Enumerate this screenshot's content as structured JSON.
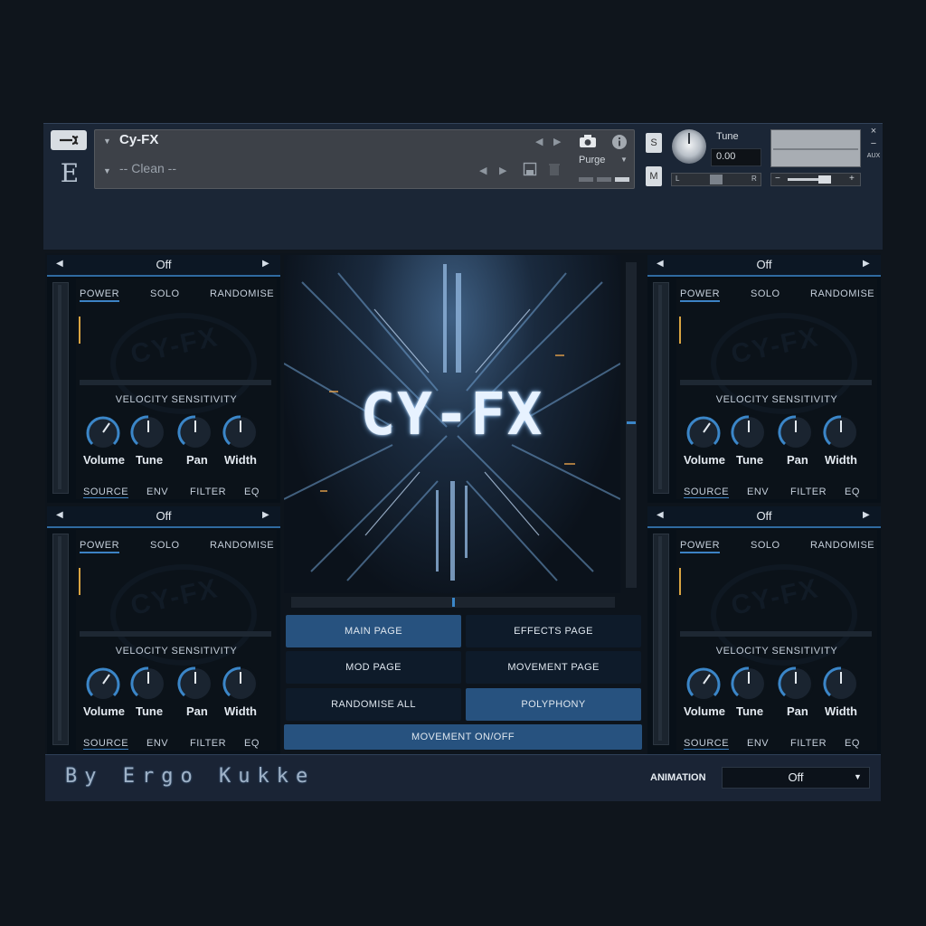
{
  "header": {
    "instrument_title": "Cy-FX",
    "snapshot": "-- Clean --",
    "purge_label": "Purge",
    "solo_label": "S",
    "mute_label": "M",
    "tune_label": "Tune",
    "tune_value": "0.00",
    "pan_left": "L",
    "pan_right": "R",
    "vol_minus": "−",
    "vol_plus": "+",
    "close": "×",
    "minimize": "−",
    "aux": "AUX",
    "e_logo": "E"
  },
  "slot_labels": {
    "power": "POWER",
    "solo": "SOLO",
    "randomise": "RANDOMISE",
    "velocity": "VELOCITY SENSITIVITY",
    "knobs": [
      "Volume",
      "Tune",
      "Pan",
      "Width"
    ],
    "source_tabs": [
      "SOURCE",
      "ENV",
      "FILTER",
      "EQ"
    ],
    "watermark": "CY-FX"
  },
  "slots": [
    {
      "value": "Off"
    },
    {
      "value": "Off"
    },
    {
      "value": "Off"
    },
    {
      "value": "Off"
    }
  ],
  "artwork": {
    "title": "CY-FX"
  },
  "center_buttons": {
    "main_page": "MAIN PAGE",
    "effects_page": "EFFECTS PAGE",
    "mod_page": "MOD PAGE",
    "movement_page": "MOVEMENT PAGE",
    "randomise_all": "RANDOMISE ALL",
    "polyphony": "POLYPHONY",
    "movement_onoff": "MOVEMENT ON/OFF"
  },
  "footer": {
    "credit": "By Ergo Kukke",
    "animation_label": "ANIMATION",
    "animation_value": "Off"
  },
  "colors": {
    "accent": "#3c82c4",
    "button_on": "#27527f",
    "button_off": "#0e1b2a",
    "level_indicator": "#d9a442"
  }
}
